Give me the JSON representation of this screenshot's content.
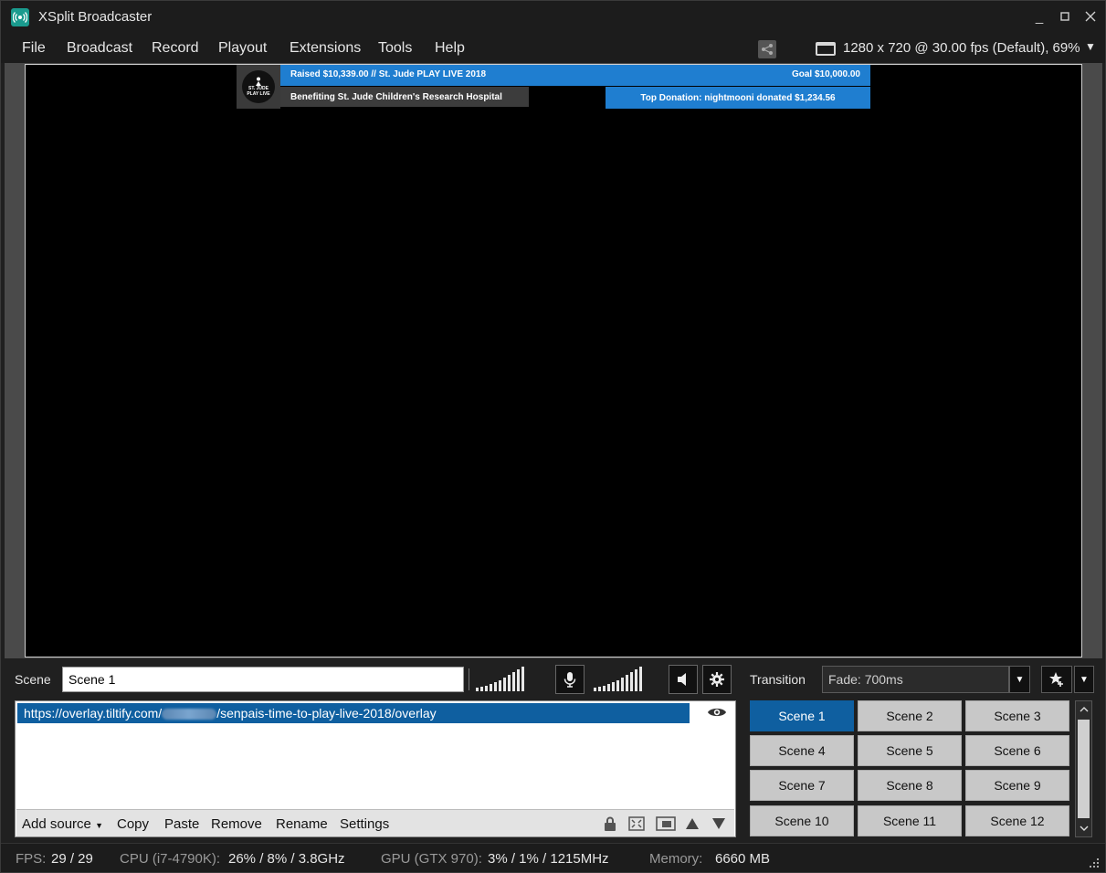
{
  "window": {
    "title": "XSplit Broadcaster"
  },
  "menu": {
    "items": [
      "File",
      "Broadcast",
      "Record",
      "Playout",
      "Extensions",
      "Tools",
      "Help"
    ],
    "resolution": "1280 x 720 @ 30.00 fps (Default), 69%"
  },
  "overlay": {
    "logo_line1": "ST. JUDE",
    "logo_line2": "PLAY LIVE",
    "raised": "Raised $10,339.00 // St. Jude PLAY LIVE 2018",
    "goal": "Goal $10,000.00",
    "benefit": "Benefiting St. Jude Children's Research Hospital",
    "top_donation": "Top Donation: nightmooni donated $1,234.56"
  },
  "scene": {
    "label": "Scene",
    "name_value": "Scene 1"
  },
  "transition": {
    "label": "Transition",
    "value": "Fade: 700ms"
  },
  "sources": {
    "items": [
      {
        "url_prefix": "https://overlay.tiltify.com/",
        "url_suffix": "/senpais-time-to-play-live-2018/overlay"
      }
    ],
    "toolbar": {
      "add_source": "Add source",
      "copy": "Copy",
      "paste": "Paste",
      "remove": "Remove",
      "rename": "Rename",
      "settings": "Settings"
    }
  },
  "scenes": [
    "Scene 1",
    "Scene 2",
    "Scene 3",
    "Scene 4",
    "Scene 5",
    "Scene 6",
    "Scene 7",
    "Scene 8",
    "Scene 9",
    "Scene 10",
    "Scene 11",
    "Scene 12"
  ],
  "status": {
    "fps_label": "FPS:",
    "fps_value": "29 / 29",
    "cpu_label": "CPU (i7-4790K):",
    "cpu_value": "26% / 8% / 3.8GHz",
    "gpu_label": "GPU (GTX 970):",
    "gpu_value": "3% / 1% / 1215MHz",
    "mem_label": "Memory:",
    "mem_value": "6660 MB"
  },
  "colors": {
    "accent": "#0f5fa0",
    "overlay_blue": "#1f7ed0",
    "app_icon": "#1a9b8e"
  }
}
